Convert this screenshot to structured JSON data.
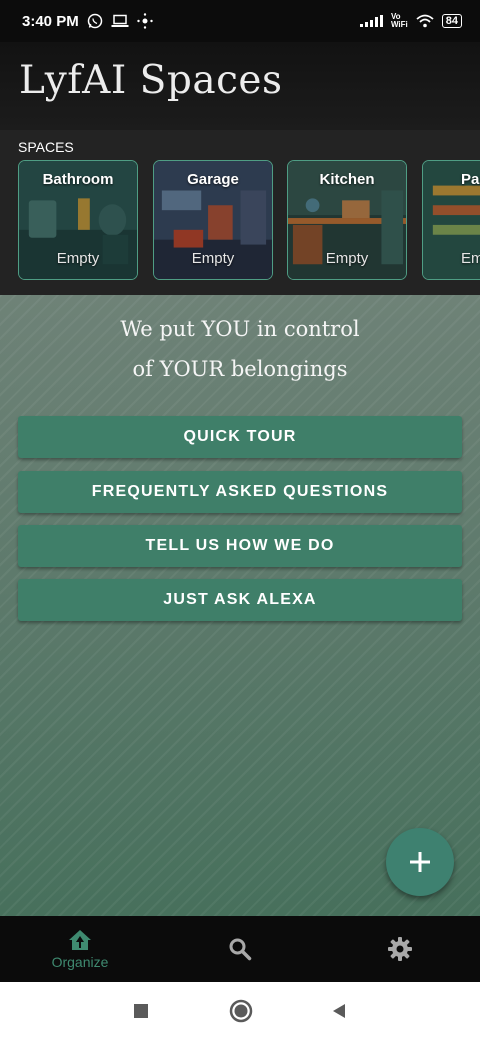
{
  "status_bar": {
    "time": "3:40 PM",
    "battery": "84",
    "vowifi_line1": "Vo",
    "vowifi_line2": "WiFi"
  },
  "header": {
    "title": "LyfAI Spaces"
  },
  "spaces": {
    "label": "SPACES",
    "items": [
      {
        "name": "Bathroom",
        "status": "Empty"
      },
      {
        "name": "Garage",
        "status": "Empty"
      },
      {
        "name": "Kitchen",
        "status": "Empty"
      },
      {
        "name": "Par",
        "status": "Em"
      }
    ]
  },
  "main": {
    "tagline_line1": "We put YOU in control",
    "tagline_line2": "of YOUR belongings",
    "buttons": [
      {
        "label": "QUICK TOUR"
      },
      {
        "label": "FREQUENTLY ASKED QUESTIONS"
      },
      {
        "label": "TELL US HOW WE DO"
      },
      {
        "label": "JUST ASK ALEXA"
      }
    ]
  },
  "fab": {
    "icon": "plus-icon"
  },
  "bottom_nav": {
    "organize_label": "Organize",
    "search_icon": "search-icon",
    "settings_icon": "gear-icon"
  },
  "colors": {
    "accent": "#3f7f69",
    "accent_text": "#3f8a70",
    "card_border": "#4f9d84"
  }
}
